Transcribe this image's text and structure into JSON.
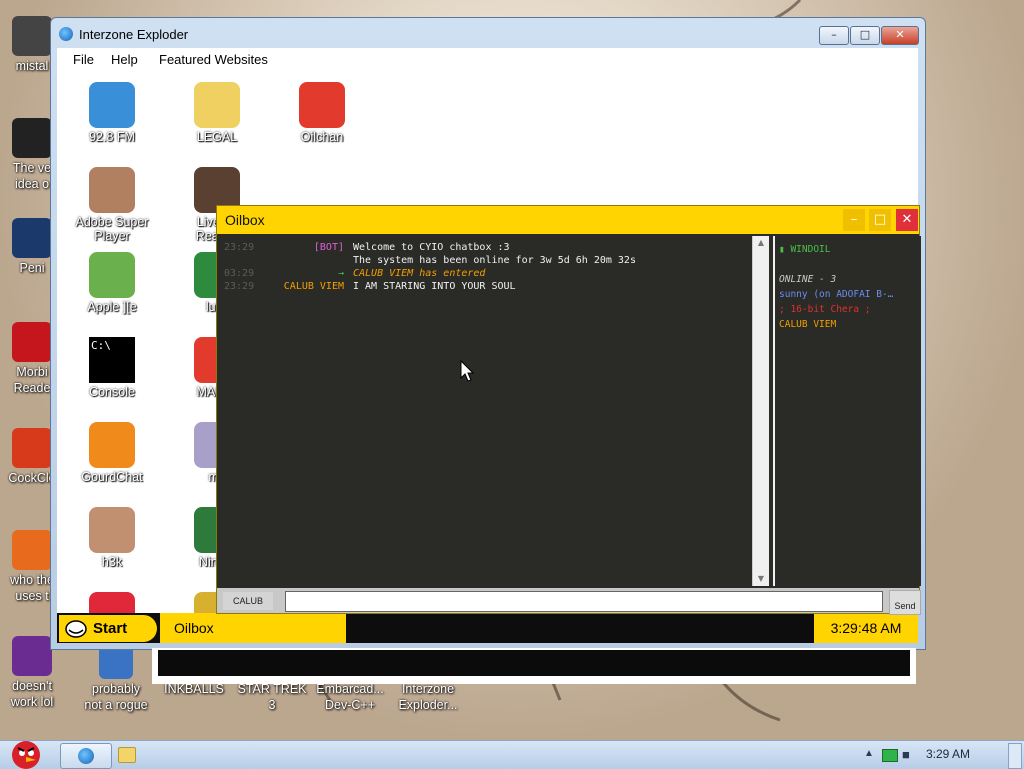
{
  "desktop": {
    "left_icons": [
      {
        "label": "mistal",
        "icon": "computer-icon",
        "color": "#444"
      },
      {
        "label": "The ve\nidea o",
        "icon": "trashcan-icon",
        "color": "#222"
      },
      {
        "label": "Peni",
        "icon": "photoshop-icon",
        "color": "#1b3a6b"
      },
      {
        "label": "Morbi\nReade",
        "icon": "pdf-reader-icon",
        "color": "#c4161c"
      },
      {
        "label": "CockCle",
        "icon": "ccleaner-icon",
        "color": "#d63a1a"
      },
      {
        "label": "who the\nuses t",
        "icon": "lightning-icon",
        "color": "#e86b1d"
      },
      {
        "label": "doesn't\nwork lol",
        "icon": "yahoo-messenger-icon",
        "color": "#6b2c91"
      }
    ],
    "bottom_icons": [
      {
        "label": "probably\nnot a rogue",
        "icon": "gears-icon",
        "color": "#3b73c4"
      },
      {
        "label": "INKBALLS",
        "icon": "inkballs-icon",
        "color": "#b07a2a"
      },
      {
        "label": "STAR TREK\n3",
        "icon": "startrek-icon",
        "color": "#555"
      },
      {
        "label": "Embarcad...\nDev-C++",
        "icon": "devcpp-icon",
        "color": "#4a6e9b"
      },
      {
        "label": "Interzone\nExploder...",
        "icon": "ie-icon",
        "color": "#2a78c9"
      }
    ]
  },
  "taskbar": {
    "clock": "3:29 AM",
    "pinned": [
      "ie-icon",
      "folder-icon"
    ]
  },
  "ie_window": {
    "title": "Interzone Exploder",
    "minimize": "–",
    "maximize": "□",
    "close": "✕",
    "menu": [
      "File",
      "Help",
      "Featured Websites"
    ],
    "icons": [
      {
        "label": "92.8 FM",
        "icon": "radio-globe-icon",
        "color": "#3a8fd9"
      },
      {
        "label": "LEGAL",
        "icon": "folder-icon",
        "color": "#f0d060"
      },
      {
        "label": "Oilchan",
        "icon": "oilchan-icon",
        "color": "#e23b2e"
      },
      {
        "label": "Adobe Super\nPlayer",
        "icon": "man-pointing-icon",
        "color": "#b08060"
      },
      {
        "label": "Live Tu\nReactio",
        "icon": "tucker-icon",
        "color": "#5a4030"
      },
      {
        "label": "",
        "icon": "skull-icon",
        "color": "#ffffff"
      },
      {
        "label": "Apple ][e",
        "icon": "apple-icon",
        "color": "#6ab04c"
      },
      {
        "label": "luigi",
        "icon": "luigi-icon",
        "color": "#2e8b3d"
      },
      {
        "label": "Console",
        "icon": "console-icon",
        "color": "#000000"
      },
      {
        "label": "MARIO",
        "icon": "mario-icon",
        "color": "#e23b2e"
      },
      {
        "label": "GourdChat",
        "icon": "pumpkin-icon",
        "color": "#f08a1a"
      },
      {
        "label": "me",
        "icon": "me-icon",
        "color": "#a8a0c8"
      },
      {
        "label": "h3k",
        "icon": "h3k-face-icon",
        "color": "#c09070"
      },
      {
        "label": "Ninten",
        "icon": "n64-icon",
        "color": "#2d7a3a"
      },
      {
        "label": "",
        "icon": "red-logo-icon",
        "color": "#e0283a"
      },
      {
        "label": "",
        "icon": "yellow-icon",
        "color": "#d8b030"
      }
    ],
    "console_prompt": "C:\\",
    "taskbar": {
      "start": "Start",
      "task": "Oilbox",
      "clock": "3:29:48 AM"
    }
  },
  "oilbox": {
    "title": "Oilbox",
    "chat": [
      {
        "time": "23:29",
        "nick": "[BOT]",
        "nick_color": "#e060d0",
        "msg": "Welcome to CYIO chatbox :3",
        "msg_color": "#f2f2f2",
        "italic": false
      },
      {
        "time": "",
        "nick": "",
        "nick_color": "#e060d0",
        "msg": "The system has been online for 3w 5d 6h 20m 32s",
        "msg_color": "#f2f2f2",
        "italic": false
      },
      {
        "time": "03:29",
        "nick": "→",
        "nick_color": "#48c048",
        "msg": "CALUB VIEM has entered",
        "msg_color": "#f0a000",
        "italic": true
      },
      {
        "time": "23:29",
        "nick": "CALUB VIEM",
        "nick_color": "#f0a000",
        "msg": "I AM STARING INTO YOUR SOUL",
        "msg_color": "#f2f2f2",
        "italic": false
      }
    ],
    "sidebar": {
      "channel": "▮ WINDOIL",
      "channel_color": "#48c048",
      "online_header": "ONLINE - 3",
      "users": [
        {
          "name": "sunny (on ADOFAI B-…",
          "color": "#6a8ef0"
        },
        {
          "name": "; 16-bit Chera ;",
          "color": "#e03030"
        },
        {
          "name": "CALUB VIEM",
          "color": "#f0a000"
        }
      ]
    },
    "input": {
      "nick": "CALUB",
      "value": "",
      "send": "Send"
    },
    "colors": {
      "accent": "#ffd400",
      "bg": "#2a2a27",
      "close": "#e0303a"
    }
  }
}
